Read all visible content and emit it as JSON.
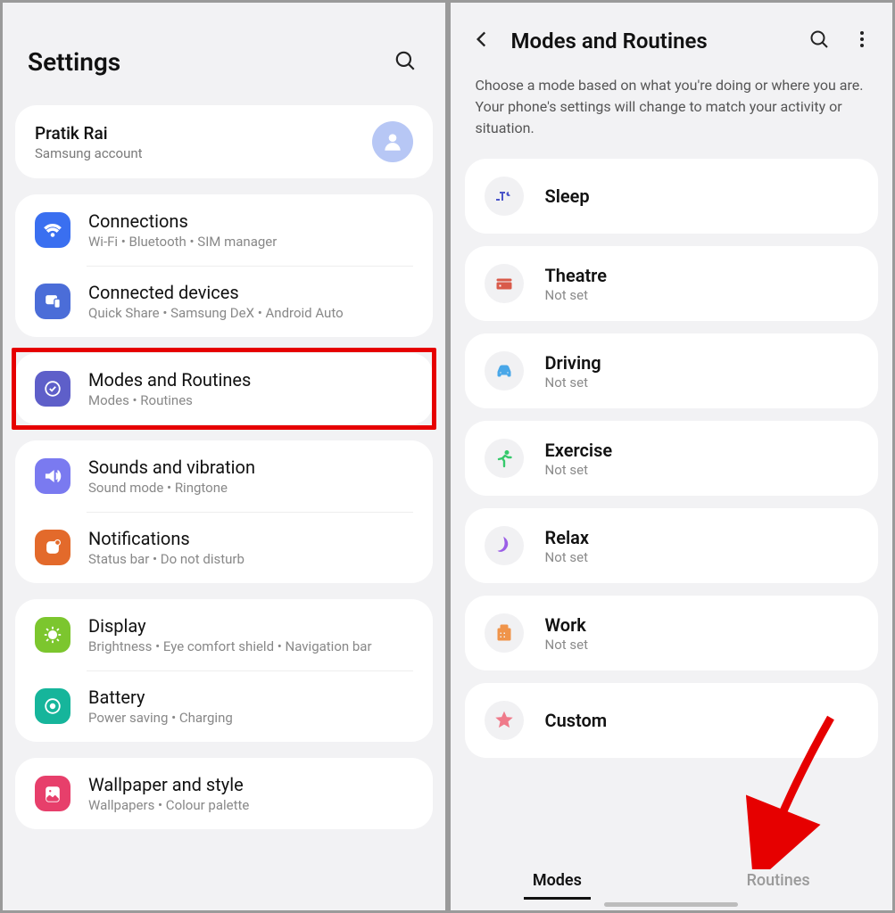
{
  "left": {
    "title": "Settings",
    "account": {
      "name": "Pratik Rai",
      "sub": "Samsung account"
    },
    "groups": [
      {
        "rows": [
          {
            "icon": "wifi",
            "color": "#3a6ff0",
            "title": "Connections",
            "sub": "Wi-Fi  •  Bluetooth  •  SIM manager"
          },
          {
            "icon": "devices",
            "color": "#4b6dd8",
            "title": "Connected devices",
            "sub": "Quick Share  •  Samsung DeX  •  Android Auto"
          }
        ]
      },
      {
        "highlight": true,
        "rows": [
          {
            "icon": "routines",
            "color": "#5e5fc9",
            "title": "Modes and Routines",
            "sub": "Modes  •  Routines"
          }
        ]
      },
      {
        "rows": [
          {
            "icon": "sound",
            "color": "#7a7af0",
            "title": "Sounds and vibration",
            "sub": "Sound mode  •  Ringtone"
          },
          {
            "icon": "notif",
            "color": "#e36a2b",
            "title": "Notifications",
            "sub": "Status bar  •  Do not disturb"
          }
        ]
      },
      {
        "rows": [
          {
            "icon": "display",
            "color": "#7cc62e",
            "title": "Display",
            "sub": "Brightness  •  Eye comfort shield  •  Navigation bar"
          },
          {
            "icon": "battery",
            "color": "#16b59b",
            "title": "Battery",
            "sub": "Power saving  •  Charging"
          }
        ]
      },
      {
        "rows": [
          {
            "icon": "wallpaper",
            "color": "#e73f6b",
            "title": "Wallpaper and style",
            "sub": "Wallpapers  •  Colour palette"
          }
        ]
      }
    ]
  },
  "right": {
    "title": "Modes and Routines",
    "desc": "Choose a mode based on what you're doing or where you are. Your phone's settings will change to match your activity or situation.",
    "modes": [
      {
        "icon": "sleep",
        "color": "#4a55c9",
        "name": "Sleep",
        "sub": ""
      },
      {
        "icon": "theatre",
        "color": "#d95a4a",
        "name": "Theatre",
        "sub": "Not set"
      },
      {
        "icon": "driving",
        "color": "#49a7e8",
        "name": "Driving",
        "sub": "Not set"
      },
      {
        "icon": "exercise",
        "color": "#35c96b",
        "name": "Exercise",
        "sub": "Not set"
      },
      {
        "icon": "relax",
        "color": "#9b5ee6",
        "name": "Relax",
        "sub": "Not set"
      },
      {
        "icon": "work",
        "color": "#f0944a",
        "name": "Work",
        "sub": "Not set"
      },
      {
        "icon": "custom",
        "color": "#ef7a8a",
        "name": "Custom",
        "sub": ""
      }
    ],
    "tabs": {
      "modes": "Modes",
      "routines": "Routines"
    }
  }
}
